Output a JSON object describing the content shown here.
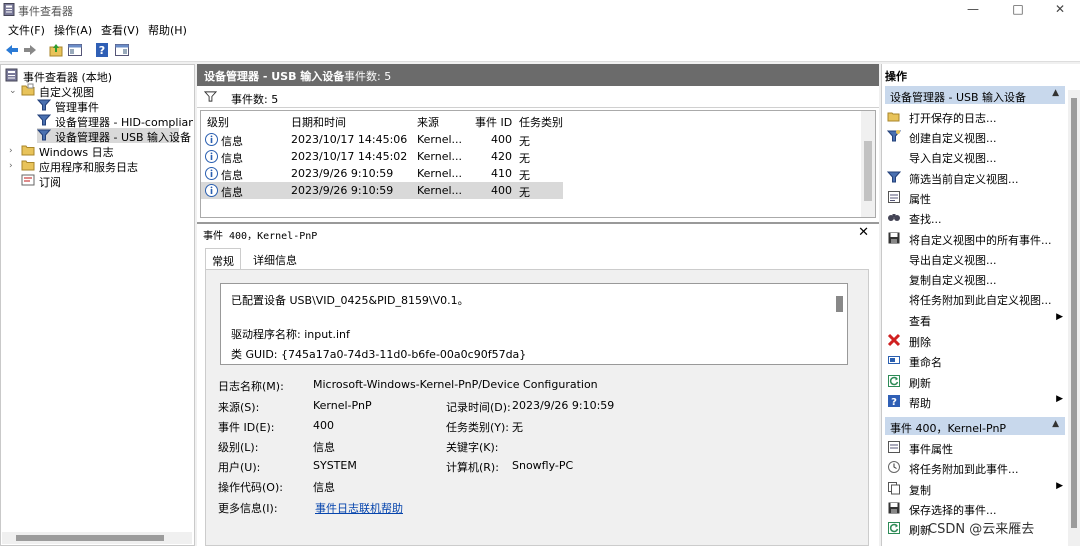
{
  "window": {
    "title": "事件查看器",
    "controls": [
      "—",
      "□",
      "✕"
    ]
  },
  "menu": [
    "文件(F)",
    "操作(A)",
    "查看(V)",
    "帮助(H)"
  ],
  "tree": {
    "root": "事件查看器 (本地)",
    "custom_views": "自定义视图",
    "admin_events": "管理事件",
    "hid_view": "设备管理器 - HID-compliant m",
    "usb_view": "设备管理器 - USB 输入设备",
    "windows_logs": "Windows 日志",
    "app_logs": "应用程序和服务日志",
    "subscriptions": "订阅"
  },
  "center": {
    "title": "设备管理器 - USB 输入设备",
    "count": "事件数: 5",
    "filter_count": "事件数: 5",
    "columns": [
      "级别",
      "日期和时间",
      "来源",
      "事件 ID",
      "任务类别"
    ],
    "rows": [
      {
        "level": "信息",
        "datetime": "2023/10/17 14:45:06",
        "source": "Kernel...",
        "id": "400",
        "task": "无"
      },
      {
        "level": "信息",
        "datetime": "2023/10/17 14:45:02",
        "source": "Kernel...",
        "id": "420",
        "task": "无"
      },
      {
        "level": "信息",
        "datetime": "2023/9/26 9:10:59",
        "source": "Kernel...",
        "id": "410",
        "task": "无"
      },
      {
        "level": "信息",
        "datetime": "2023/9/26 9:10:59",
        "source": "Kernel...",
        "id": "400",
        "task": "无"
      }
    ]
  },
  "detail": {
    "header": "事件 400，Kernel-PnP",
    "close": "✕",
    "tabs": [
      "常规",
      "详细信息"
    ],
    "description": [
      "已配置设备 USB\\VID_0425&PID_8159\\V0.1。",
      "驱动程序名称: input.inf",
      "类 GUID: {745a17a0-74d3-11d0-b6fe-00a0c90f57da}"
    ],
    "props": {
      "log_name_label": "日志名称(M):",
      "log_name": "Microsoft-Windows-Kernel-PnP/Device Configuration",
      "source_label": "来源(S):",
      "source": "Kernel-PnP",
      "logged_label": "记录时间(D):",
      "logged": "2023/9/26 9:10:59",
      "event_id_label": "事件 ID(E):",
      "event_id": "400",
      "task_label": "任务类别(Y):",
      "task": "无",
      "level_label": "级别(L):",
      "level": "信息",
      "keywords_label": "关键字(K):",
      "keywords": "",
      "user_label": "用户(U):",
      "user": "SYSTEM",
      "computer_label": "计算机(R):",
      "computer": "Snowfly-PC",
      "opcode_label": "操作代码(O):",
      "opcode": "信息",
      "more_label": "更多信息(I):",
      "more_link": "事件日志联机帮助"
    }
  },
  "actions": {
    "header": "操作",
    "section1": "设备管理器 - USB 输入设备",
    "items1": [
      "打开保存的日志...",
      "创建自定义视图...",
      "导入自定义视图...",
      "筛选当前自定义视图...",
      "属性",
      "查找...",
      "将自定义视图中的所有事件...",
      "导出自定义视图...",
      "复制自定义视图...",
      "将任务附加到此自定义视图...",
      "查看",
      "删除",
      "重命名",
      "刷新",
      "帮助"
    ],
    "section2": "事件 400，Kernel-PnP",
    "items2": [
      "事件属性",
      "将任务附加到此事件...",
      "复制",
      "保存选择的事件...",
      "刷新"
    ]
  },
  "watermark": "CSDN @云来雁去"
}
